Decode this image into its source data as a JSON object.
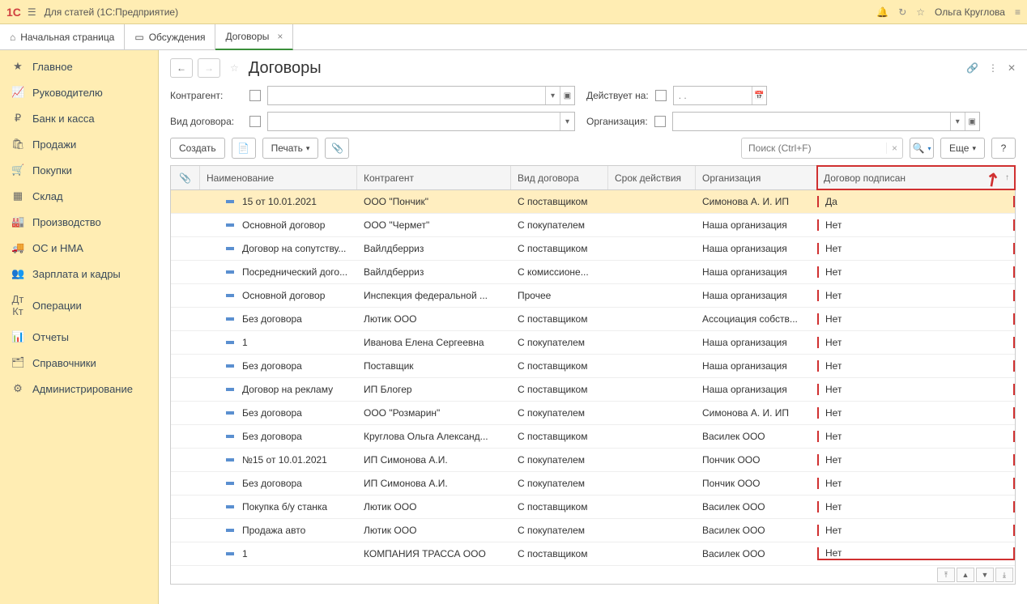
{
  "header": {
    "logo": "1Ϲ",
    "title": "Для статей (1С:Предприятие)",
    "user": "Ольга Круглова"
  },
  "tabs": [
    {
      "label": "Начальная страница",
      "icon": "home"
    },
    {
      "label": "Обсуждения",
      "icon": "chat"
    },
    {
      "label": "Договоры",
      "icon": "",
      "closable": true,
      "active": true
    }
  ],
  "sidebar": [
    {
      "label": "Главное",
      "icon": "★"
    },
    {
      "label": "Руководителю",
      "icon": "📈"
    },
    {
      "label": "Банк и касса",
      "icon": "₽"
    },
    {
      "label": "Продажи",
      "icon": "🛍"
    },
    {
      "label": "Покупки",
      "icon": "🛒"
    },
    {
      "label": "Склад",
      "icon": "▦"
    },
    {
      "label": "Производство",
      "icon": "🏭"
    },
    {
      "label": "ОС и НМА",
      "icon": "🚚"
    },
    {
      "label": "Зарплата и кадры",
      "icon": "👥"
    },
    {
      "label": "Операции",
      "icon": "Дт Кт"
    },
    {
      "label": "Отчеты",
      "icon": "📊"
    },
    {
      "label": "Справочники",
      "icon": "🗂"
    },
    {
      "label": "Администрирование",
      "icon": "⚙"
    }
  ],
  "page": {
    "title": "Договоры",
    "filters": {
      "contragent_label": "Контрагент:",
      "contract_type_label": "Вид договора:",
      "valid_on_label": "Действует на:",
      "organization_label": "Организация:",
      "date_placeholder": ".  ."
    },
    "toolbar": {
      "create": "Создать",
      "print": "Печать",
      "search_placeholder": "Поиск (Ctrl+F)",
      "more": "Еще",
      "help": "?"
    },
    "columns": {
      "clip": "📎",
      "name": "Наименование",
      "contragent": "Контрагент",
      "type": "Вид договора",
      "period": "Срок действия",
      "org": "Организация",
      "signed": "Договор подписан"
    },
    "rows": [
      {
        "name": "15 от 10.01.2021",
        "contragent": "ООО \"Пончик\"",
        "type": "С поставщиком",
        "period": "",
        "org": "Симонова А. И. ИП",
        "signed": "Да",
        "selected": true
      },
      {
        "name": "Основной договор",
        "contragent": "ООО \"Чермет\"",
        "type": "С покупателем",
        "period": "",
        "org": "Наша организация",
        "signed": "Нет"
      },
      {
        "name": "Договор на сопутству...",
        "contragent": "Вайлдберриз",
        "type": "С поставщиком",
        "period": "",
        "org": "Наша организация",
        "signed": "Нет"
      },
      {
        "name": "Посреднический дого...",
        "contragent": "Вайлдберриз",
        "type": "С комиссионе...",
        "period": "",
        "org": "Наша организация",
        "signed": "Нет"
      },
      {
        "name": "Основной договор",
        "contragent": "Инспекция федеральной ...",
        "type": "Прочее",
        "period": "",
        "org": "Наша организация",
        "signed": "Нет"
      },
      {
        "name": "Без договора",
        "contragent": "Лютик ООО",
        "type": "С поставщиком",
        "period": "",
        "org": "Ассоциация собств...",
        "signed": "Нет"
      },
      {
        "name": "1",
        "contragent": "Иванова Елена Сергеевна",
        "type": "С покупателем",
        "period": "",
        "org": "Наша организация",
        "signed": "Нет"
      },
      {
        "name": "Без договора",
        "contragent": "Поставщик",
        "type": "С поставщиком",
        "period": "",
        "org": "Наша организация",
        "signed": "Нет"
      },
      {
        "name": "Договор на рекламу",
        "contragent": "ИП Блогер",
        "type": "С поставщиком",
        "period": "",
        "org": "Наша организация",
        "signed": "Нет"
      },
      {
        "name": "Без договора",
        "contragent": "ООО \"Розмарин\"",
        "type": "С покупателем",
        "period": "",
        "org": "Симонова А. И. ИП",
        "signed": "Нет"
      },
      {
        "name": "Без договора",
        "contragent": "Круглова Ольга Александ...",
        "type": "С поставщиком",
        "period": "",
        "org": "Василек ООО",
        "signed": "Нет"
      },
      {
        "name": "№15 от 10.01.2021",
        "contragent": "ИП Симонова А.И.",
        "type": "С покупателем",
        "period": "",
        "org": "Пончик ООО",
        "signed": "Нет"
      },
      {
        "name": "Без договора",
        "contragent": "ИП Симонова А.И.",
        "type": "С покупателем",
        "period": "",
        "org": "Пончик ООО",
        "signed": "Нет"
      },
      {
        "name": "Покупка б/у станка",
        "contragent": "Лютик ООО",
        "type": "С поставщиком",
        "period": "",
        "org": "Василек ООО",
        "signed": "Нет"
      },
      {
        "name": "Продажа авто",
        "contragent": "Лютик ООО",
        "type": "С покупателем",
        "period": "",
        "org": "Василек ООО",
        "signed": "Нет"
      },
      {
        "name": "1",
        "contragent": "КОМПАНИЯ ТРАССА ООО",
        "type": "С поставщиком",
        "period": "",
        "org": "Василек ООО",
        "signed": "Нет"
      }
    ]
  }
}
